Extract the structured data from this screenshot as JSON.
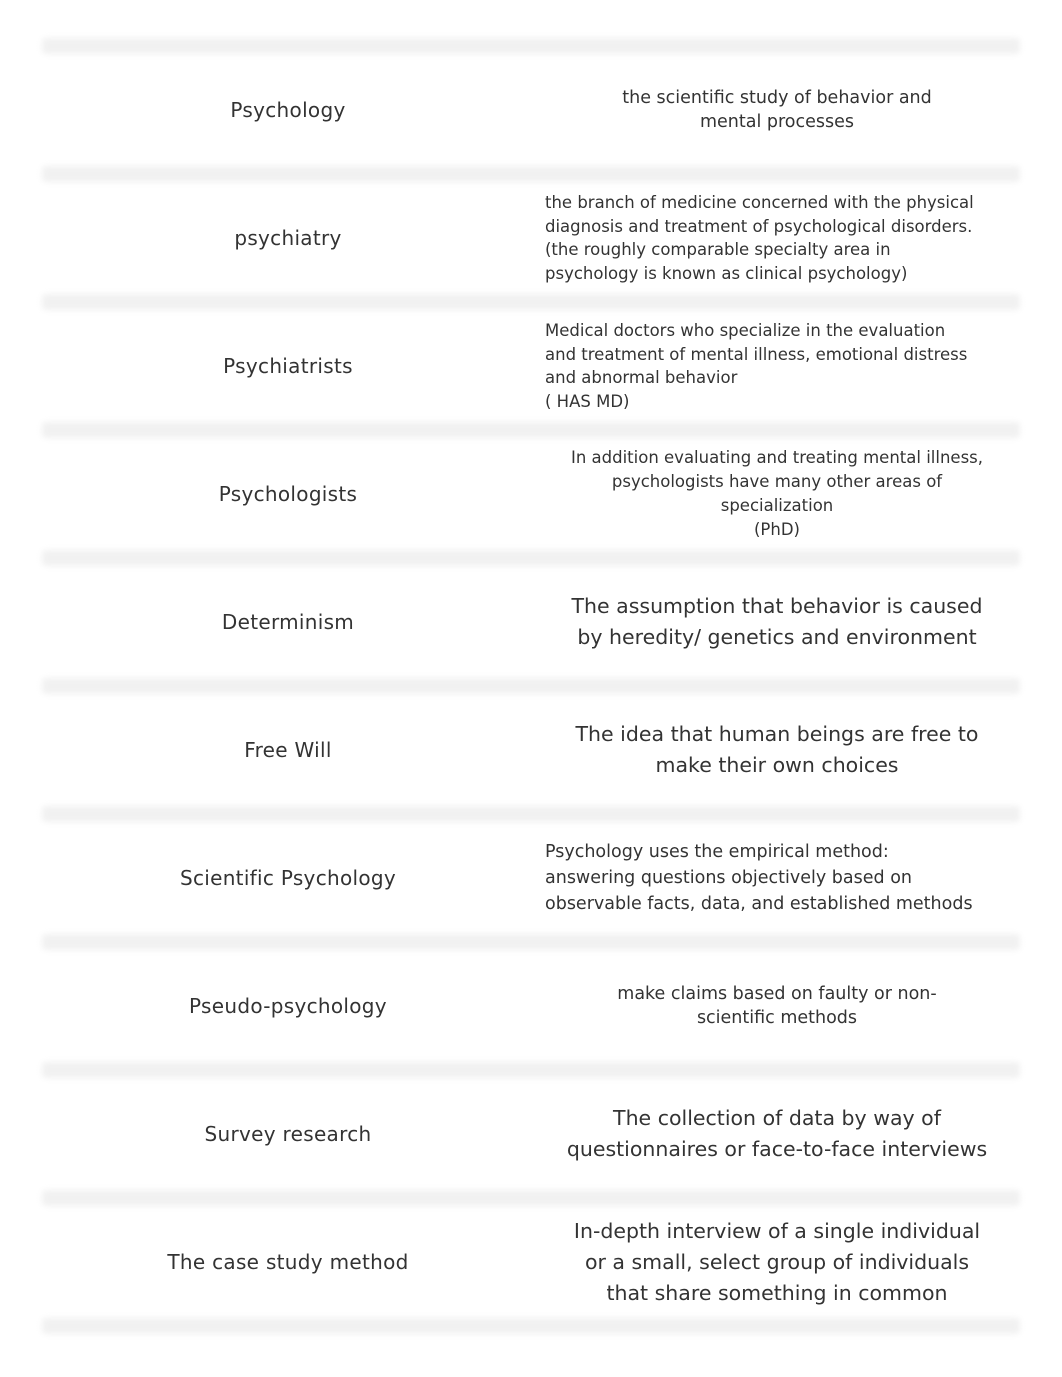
{
  "cards": [
    {
      "term": "Psychology",
      "definition": "the scientific study of behavior and\nmental processes",
      "style": "md"
    },
    {
      "term": "psychiatry",
      "definition": "the branch of medicine concerned with the physical\ndiagnosis and treatment of psychological disorders.\n(the roughly comparable specialty area in\npsychology is known as clinical psychology)",
      "style": "sm"
    },
    {
      "term": "Psychiatrists",
      "definition": "Medical doctors who specialize in the evaluation\nand treatment of mental illness, emotional distress\nand abnormal behavior\n( HAS MD)",
      "style": "sm"
    },
    {
      "term": "Psychologists",
      "definition": "In addition evaluating and treating mental illness,\npsychologists have many other areas of\nspecialization\n(PhD)",
      "style": "sm2"
    },
    {
      "term": "Determinism",
      "definition": "The assumption that behavior is caused\nby heredity/ genetics and environment",
      "style": "lg"
    },
    {
      "term": "Free Will",
      "definition": "The idea that human beings are free to\nmake their own choices",
      "style": "lg"
    },
    {
      "term": "Scientific Psychology",
      "definition": "Psychology uses the empirical method:\nanswering questions objectively based on\nobservable facts, data, and established methods",
      "style": "smL"
    },
    {
      "term": "Pseudo-psychology",
      "definition": "make claims based on faulty or non-\nscientific methods",
      "style": "md"
    },
    {
      "term": "Survey research",
      "definition": "The collection of data by way of\nquestionnaires or face-to-face interviews",
      "style": "lg"
    },
    {
      "term": "The case study method",
      "definition": "In-depth interview of a single individual\nor a small, select group of individuals\nthat share something in common",
      "style": "lg"
    }
  ]
}
